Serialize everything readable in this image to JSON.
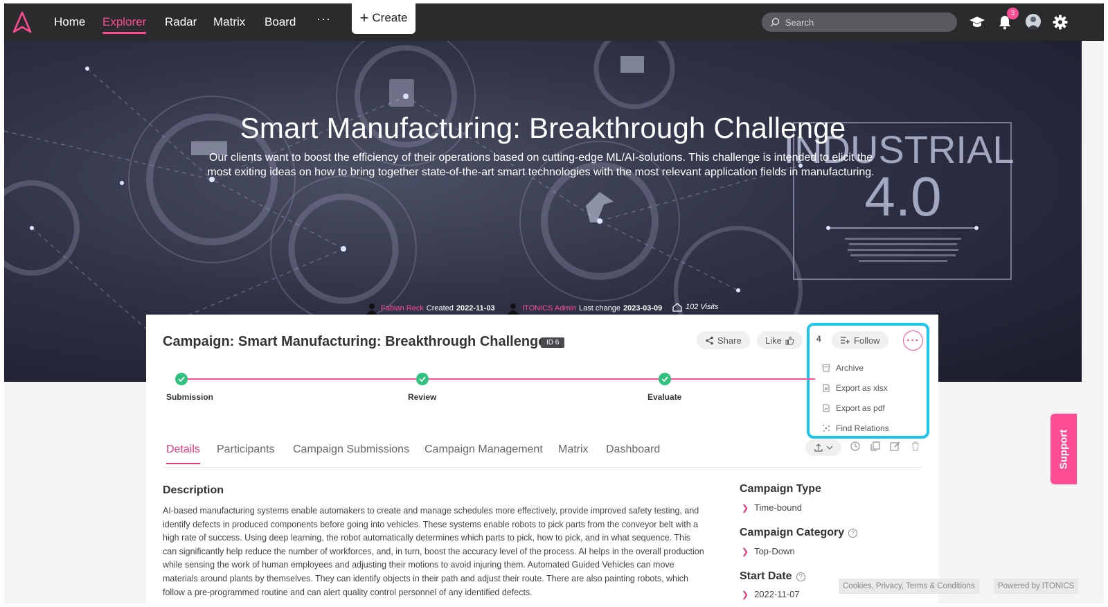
{
  "nav": {
    "items": [
      "Home",
      "Explorer",
      "Radar",
      "Matrix",
      "Board"
    ],
    "active": "Explorer",
    "more": "···",
    "create_label": "Create",
    "search_placeholder": "Search",
    "notification_count": "3"
  },
  "hero": {
    "title": "Smart Manufacturing: Breakthrough Challenge",
    "subtitle": "Our clients want to boost the efficiency of their operations based on cutting-edge ML/AI-solutions. This challenge is intended to elicit the most exiting ideas on how to bring together state-of-the-art smart technologies with the most relevant application fields in manufacturing.",
    "banner_word": "INDUSTRIAL",
    "banner_version": "4.0",
    "creator": "Fabian Reck",
    "created_label": "Created",
    "created_date": "2022-11-03",
    "modifier": "ITONICS Admin",
    "changed_label": "Last change",
    "changed_date": "2023-03-09",
    "visits": "102 Visits"
  },
  "card": {
    "title": "Campaign: Smart Manufacturing: Breakthrough Challenge",
    "id_badge": "ID 6",
    "share_label": "Share",
    "like_label": "Like",
    "follow_count": "4",
    "follow_label": "Follow",
    "menu": [
      {
        "label": "Archive",
        "icon": "archive-icon"
      },
      {
        "label": "Export as xlsx",
        "icon": "xlsx-file-icon"
      },
      {
        "label": "Export as pdf",
        "icon": "pdf-file-icon"
      },
      {
        "label": "Find Relations",
        "icon": "relations-icon"
      }
    ],
    "steps": [
      "Submission",
      "Review",
      "Evaluate"
    ],
    "tabs": [
      "Details",
      "Participants",
      "Campaign Submissions",
      "Campaign Management",
      "Matrix",
      "Dashboard"
    ],
    "active_tab": "Details",
    "description_heading": "Description",
    "description": "AI-based manufacturing systems enable automakers to create and manage schedules more effectively, provide improved safety testing, and identify defects in produced components before going into vehicles. These systems enable robots to pick parts from the conveyor belt with a high rate of success. Using deep learning, the robot automatically determines which parts to pick, how to pick, and in what sequence. This can significantly help reduce the number of workforces, and, in turn, boost the accuracy level of the process. AI helps in the overall production while sensing the work of human employees and adjusting their motions to avoid injuring them. Automated Guided Vehicles can move materials around plants by themselves. They can identify objects in their path and adjust their route. There are also painting robots, which follow a pre-programmed routine and can alert quality control personnel of any identified defects.",
    "campaign_type_label": "Campaign Type",
    "campaign_type": "Time-bound",
    "campaign_category_label": "Campaign Category",
    "campaign_category": "Top-Down",
    "start_date_label": "Start Date",
    "start_date": "2022-11-07"
  },
  "support_label": "Support",
  "footer": {
    "legal": "Cookies, Privacy, Terms & Conditions",
    "powered": "Powered by ITONICS"
  },
  "colors": {
    "accent": "#ff4d94",
    "nav_bg": "#2b2b2e",
    "step_done": "#2ec27e",
    "highlight": "#1ec6ee"
  }
}
